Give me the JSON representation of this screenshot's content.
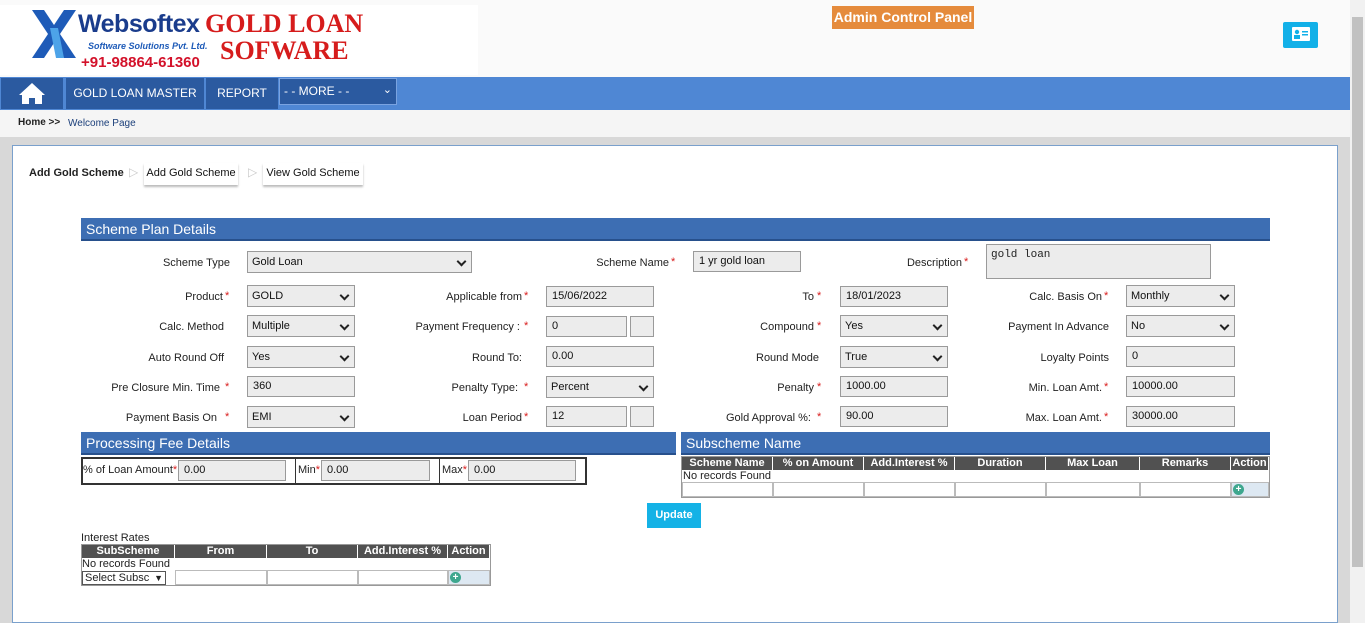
{
  "header": {
    "brand": "Websoftex",
    "brand_sub": "Software Solutions Pvt. Ltd.",
    "phone": "+91-98864-61360",
    "product_line1": "GOLD LOAN",
    "product_line2": "SOFWARE",
    "admin_panel": "Admin Control Panel"
  },
  "nav": {
    "items": [
      "GOLD LOAN MASTER",
      "REPORT"
    ],
    "more": "- - MORE - -"
  },
  "breadcrumb": {
    "home": "Home >>",
    "page": "Welcome Page"
  },
  "tabs": {
    "current": "Add Gold Scheme",
    "tab1": "Add Gold Scheme",
    "tab2": "View Gold Scheme"
  },
  "scheme": {
    "title": "Scheme Plan Details",
    "scheme_type_label": "Scheme Type",
    "scheme_type": "Gold Loan",
    "scheme_name_label": "Scheme Name",
    "scheme_name": "1 yr gold loan",
    "description_label": "Description",
    "description": "gold loan",
    "product_label": "Product",
    "product": "GOLD",
    "applicable_from_label": "Applicable from",
    "applicable_from": "15/06/2022",
    "to_label": "To",
    "to": "18/01/2023",
    "calc_basis_label": "Calc. Basis On",
    "calc_basis": "Monthly",
    "calc_method_label": "Calc. Method",
    "calc_method": "Multiple",
    "payment_freq_label": "Payment Frequency :",
    "payment_freq": "0",
    "compound_label": "Compound",
    "compound": "Yes",
    "payment_advance_label": "Payment In Advance",
    "payment_advance": "No",
    "auto_round_label": "Auto Round Off",
    "auto_round": "Yes",
    "round_to_label": "Round To:",
    "round_to": "0.00",
    "round_mode_label": "Round Mode",
    "round_mode": "True",
    "loyalty_label": "Loyalty Points",
    "loyalty": "0",
    "preclosure_label": "Pre Closure Min. Time",
    "preclosure": "360",
    "penalty_type_label": "Penalty Type:",
    "penalty_type": "Percent",
    "penalty_label": "Penalty",
    "penalty": "1000.00",
    "min_loan_label": "Min. Loan Amt.",
    "min_loan": "10000.00",
    "payment_basis_label": "Payment Basis On",
    "payment_basis": "EMI",
    "loan_period_label": "Loan Period",
    "loan_period": "12",
    "gold_approval_label": "Gold Approval %:",
    "gold_approval": "90.00",
    "max_loan_label": "Max. Loan Amt.",
    "max_loan": "30000.00"
  },
  "processing": {
    "title": "Processing Fee Details",
    "pct_label": "% of Loan Amount",
    "pct": "0.00",
    "min_label": "Min",
    "min": "0.00",
    "max_label": "Max",
    "max": "0.00"
  },
  "subscheme": {
    "title": "Subscheme Name",
    "columns": [
      "Scheme Name",
      "% on Amount",
      "Add.Interest %",
      "Duration",
      "Max Loan Amount",
      "Remarks",
      "Action"
    ],
    "empty": "No records Found"
  },
  "update_label": "Update",
  "interest": {
    "title": "Interest Rates",
    "columns": [
      "SubScheme name",
      "From",
      "To",
      "Add.Interest %",
      "Action"
    ],
    "empty": "No records Found",
    "select": "Select Subsc"
  }
}
